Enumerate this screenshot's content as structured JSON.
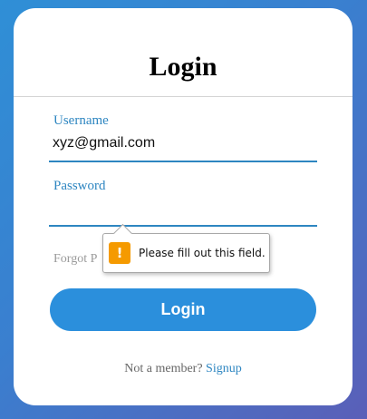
{
  "form": {
    "title": "Login",
    "username": {
      "label": "Username",
      "value": "xyz@gmail.com"
    },
    "password": {
      "label": "Password",
      "value": ""
    },
    "forgot_text": "Forgot P",
    "submit_label": "Login",
    "signup_prompt": "Not a member?",
    "signup_link": "Signup"
  },
  "validation_tooltip": {
    "icon": "warning-icon",
    "icon_glyph": "!",
    "message": "Please fill out this field."
  },
  "colors": {
    "accent": "#2e86c1",
    "button": "#2b8fdc",
    "warning": "#f59a00"
  }
}
